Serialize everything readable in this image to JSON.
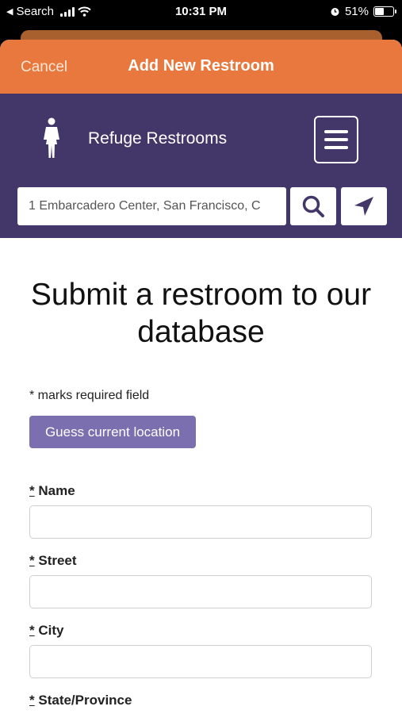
{
  "status_bar": {
    "back_label": "Search",
    "time": "10:31 PM",
    "battery_percent": "51%",
    "battery_level": 0.51
  },
  "modal": {
    "cancel_label": "Cancel",
    "title": "Add New Restroom"
  },
  "site_header": {
    "brand": "Refuge Restrooms",
    "logo_icon": "person-icon",
    "menu_icon": "hamburger-menu-icon",
    "search": {
      "value": "1 Embarcadero Center, San Francisco, C",
      "search_icon": "search-icon",
      "locate_icon": "location-arrow-icon"
    }
  },
  "form": {
    "title": "Submit a restroom to our database",
    "required_note": "* marks required field",
    "guess_location_label": "Guess current location",
    "required_marker": "*",
    "fields": [
      {
        "label": "Name",
        "value": ""
      },
      {
        "label": "Street",
        "value": ""
      },
      {
        "label": "City",
        "value": ""
      },
      {
        "label": "State/Province",
        "value": ""
      }
    ]
  },
  "colors": {
    "header_orange": "#e8783e",
    "header_purple": "#433669",
    "button_purple": "#7b6fb0"
  }
}
